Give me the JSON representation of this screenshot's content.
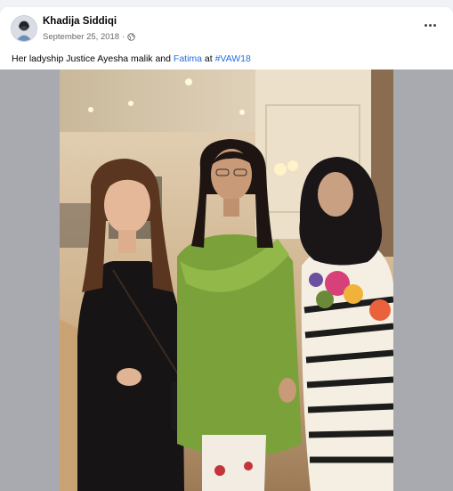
{
  "post": {
    "author": "Khadija Siddiqi",
    "date": "September 25, 2018",
    "separator": "·",
    "caption_prefix": "Her ladyship Justice Ayesha malik and ",
    "caption_tag_person": "Fatima",
    "caption_middle": " at ",
    "caption_hashtag": "#VAW18"
  },
  "icons": {
    "audience": "globe-icon",
    "menu": "more-horizontal-icon"
  },
  "colors": {
    "link": "#216fdb",
    "meta": "#65676b",
    "media_bg": "#a8aab0"
  }
}
